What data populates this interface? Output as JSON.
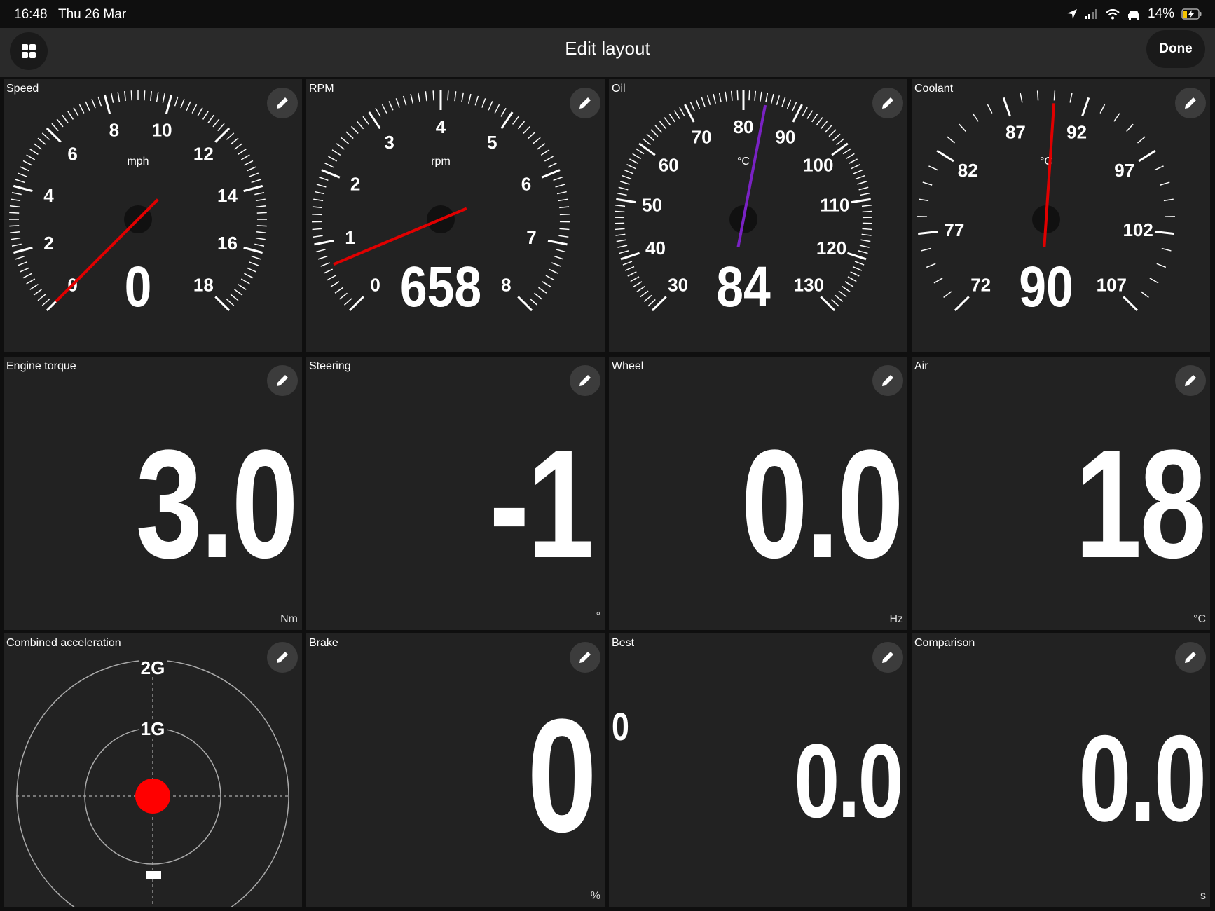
{
  "status_bar": {
    "time": "16:48",
    "date": "Thu 26 Mar",
    "battery": "14%"
  },
  "nav": {
    "title": "Edit layout",
    "done_label": "Done"
  },
  "colors": {
    "needle_red": "#e00000",
    "needle_purple": "#7a22c4",
    "dot_red": "#ff0000",
    "tile_bg": "#222222"
  },
  "gauges": [
    {
      "title": "Speed",
      "unit": "mph",
      "value": 0,
      "value_text": "0",
      "min": 0,
      "max": 18,
      "labels": [
        0,
        2,
        4,
        6,
        8,
        10,
        12,
        14,
        16,
        18
      ],
      "minor_per_major": 10,
      "needle_color": "#e00000"
    },
    {
      "title": "RPM",
      "unit": "rpm",
      "value": 0.658,
      "value_text": "658",
      "min": 0,
      "max": 8,
      "labels": [
        0,
        1,
        2,
        3,
        4,
        5,
        6,
        7,
        8
      ],
      "minor_per_major": 10,
      "needle_color": "#e00000"
    },
    {
      "title": "Oil",
      "unit": "°C",
      "value": 84,
      "value_text": "84",
      "min": 30,
      "max": 130,
      "labels": [
        30,
        40,
        50,
        60,
        70,
        80,
        90,
        100,
        110,
        120,
        130
      ],
      "minor_per_major": 10,
      "needle_color": "#7a22c4"
    },
    {
      "title": "Coolant",
      "unit": "°C",
      "value": 90,
      "value_text": "90",
      "min": 72,
      "max": 107,
      "labels": [
        72,
        77,
        82,
        87,
        92,
        97,
        102,
        107
      ],
      "minor_per_major": 5,
      "needle_color": "#e00000"
    }
  ],
  "numeric_tiles": [
    {
      "title": "Engine torque",
      "value": "3.0",
      "unit": "Nm"
    },
    {
      "title": "Steering",
      "value": "-1",
      "unit": "°"
    },
    {
      "title": "Wheel",
      "value": "0.0",
      "unit": "Hz"
    },
    {
      "title": "Air",
      "value": "18",
      "unit": "°C"
    }
  ],
  "accel_tile": {
    "title": "Combined acceleration",
    "ring_labels": [
      "2G",
      "1G"
    ],
    "x_g": 0,
    "y_g": 0
  },
  "bottom_tiles": [
    {
      "title": "Brake",
      "value": "0",
      "unit": "%"
    },
    {
      "title": "Best",
      "value": "0.0",
      "superscript": "0",
      "unit": ""
    },
    {
      "title": "Comparison",
      "value": "0.0",
      "unit": "s"
    }
  ]
}
